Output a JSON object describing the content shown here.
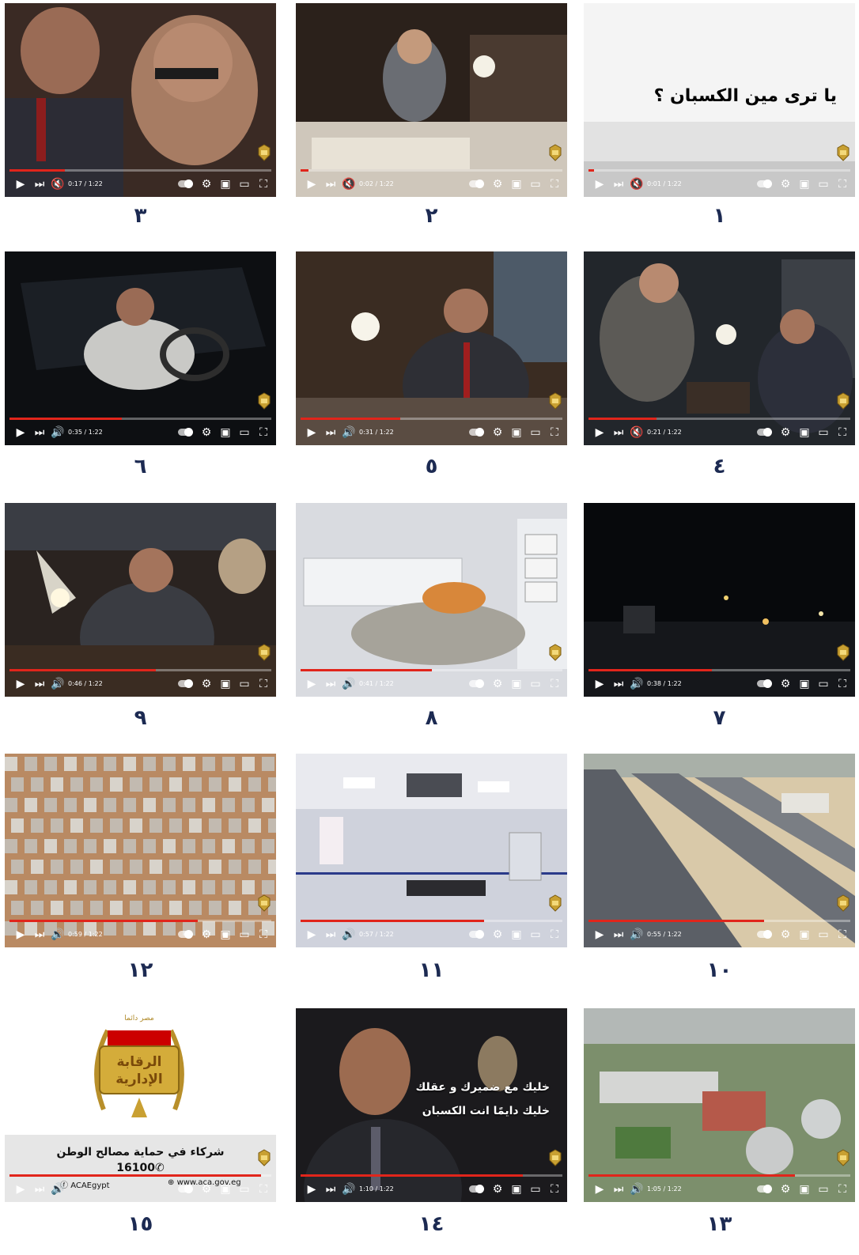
{
  "colors": {
    "progress": "#e1251b",
    "number": "#1c2a52"
  },
  "frames": [
    {
      "number": "١",
      "time": "0:01 / 1:22",
      "progress": 0.02,
      "volume": "muted-icon",
      "caption": "يا ترى مين الكسبان ؟",
      "scene": "white-title"
    },
    {
      "number": "٢",
      "time": "0:02 / 1:22",
      "progress": 0.03,
      "volume": "muted-icon",
      "scene": "office-desk-lamp"
    },
    {
      "number": "٣",
      "time": "0:17 / 1:22",
      "progress": 0.21,
      "volume": "muted-icon",
      "scene": "two-men-closeup"
    },
    {
      "number": "٤",
      "time": "0:21 / 1:22",
      "progress": 0.26,
      "volume": "muted-icon",
      "scene": "office-two-men"
    },
    {
      "number": "٥",
      "time": "0:31 / 1:22",
      "progress": 0.38,
      "volume": "volume-icon",
      "scene": "man-smiling-desk"
    },
    {
      "number": "٦",
      "time": "0:35 / 1:22",
      "progress": 0.43,
      "volume": "volume-icon",
      "scene": "man-in-car"
    },
    {
      "number": "٧",
      "time": "0:38 / 1:22",
      "progress": 0.47,
      "volume": "volume-icon",
      "scene": "night-road"
    },
    {
      "number": "٨",
      "time": "0:41 / 1:22",
      "progress": 0.5,
      "volume": "volume-icon",
      "scene": "ambulance-stretcher"
    },
    {
      "number": "٩",
      "time": "0:46 / 1:22",
      "progress": 0.56,
      "volume": "volume-icon",
      "scene": "man-at-desk-lamps"
    },
    {
      "number": "١٠",
      "time": "0:55 / 1:22",
      "progress": 0.67,
      "volume": "volume-icon",
      "scene": "aerial-highway"
    },
    {
      "number": "١١",
      "time": "0:57 / 1:22",
      "progress": 0.7,
      "volume": "volume-icon",
      "scene": "operating-room"
    },
    {
      "number": "١٢",
      "time": "0:59 / 1:22",
      "progress": 0.72,
      "volume": "volume-icon",
      "scene": "aerial-housing"
    },
    {
      "number": "١٣",
      "time": "1:05 / 1:22",
      "progress": 0.79,
      "volume": "volume-icon",
      "scene": "aerial-treatment-plant"
    },
    {
      "number": "١٤",
      "time": "1:10 / 1:22",
      "progress": 0.85,
      "volume": "volume-icon",
      "subtitle1": "خليك مع ضميرك و عقلك",
      "subtitle2": "خليك دايمًا انت الكسبان",
      "scene": "man-closeup-dark"
    },
    {
      "number": "١٥",
      "time": "",
      "progress": 0.96,
      "volume": "volume-icon",
      "scene": "logo-endcard",
      "logo_top": "مصر دائما",
      "logo_text1": "الرقابة",
      "logo_text2": "الإدارية",
      "slogan": "شركاء في حماية مصالح الوطن",
      "hotline": "16100",
      "facebook": "ACAEgypt",
      "website": "www.aca.gov.eg"
    }
  ]
}
